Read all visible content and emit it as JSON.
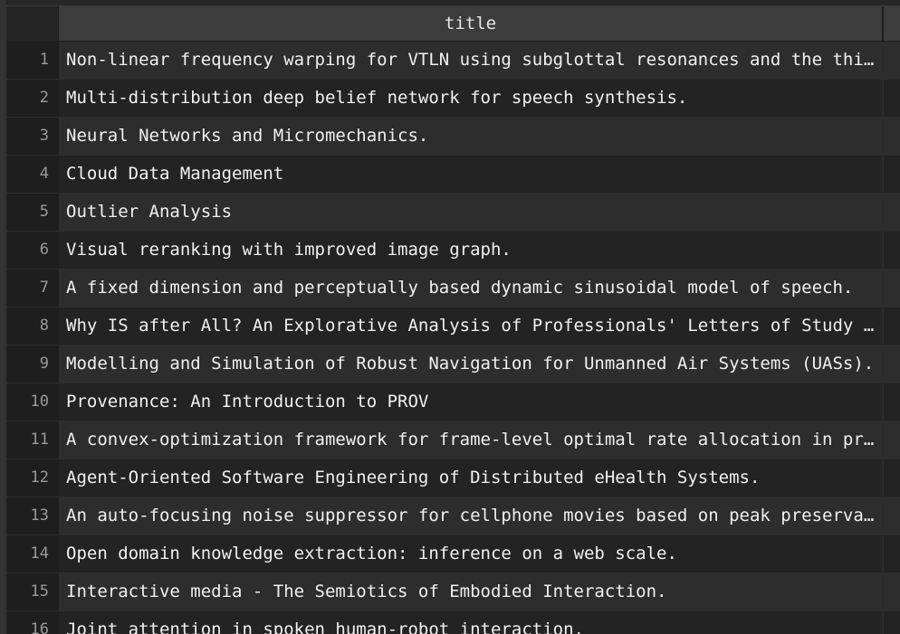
{
  "table": {
    "column_header": "title",
    "rows": [
      {
        "num": "1",
        "title": "Non-linear frequency warping for VTLN using subglottal resonances and the third formant frequency."
      },
      {
        "num": "2",
        "title": "Multi-distribution deep belief network for speech synthesis."
      },
      {
        "num": "3",
        "title": "Neural Networks and Micromechanics."
      },
      {
        "num": "4",
        "title": "Cloud Data Management"
      },
      {
        "num": "5",
        "title": "Outlier Analysis"
      },
      {
        "num": "6",
        "title": "Visual reranking with improved image graph."
      },
      {
        "num": "7",
        "title": "A fixed dimension and perceptually based dynamic sinusoidal model of speech."
      },
      {
        "num": "8",
        "title": "Why IS after All? An Explorative Analysis of Professionals' Letters of Study Motivation."
      },
      {
        "num": "9",
        "title": "Modelling and Simulation of Robust Navigation for Unmanned Air Systems (UASs)."
      },
      {
        "num": "10",
        "title": "Provenance: An Introduction to PROV"
      },
      {
        "num": "11",
        "title": "A convex-optimization framework for frame-level optimal rate allocation in predictive video coding."
      },
      {
        "num": "12",
        "title": "Agent-Oriented Software Engineering of Distributed eHealth Systems."
      },
      {
        "num": "13",
        "title": "An auto-focusing noise suppressor for cellphone movies based on peak preservation."
      },
      {
        "num": "14",
        "title": "Open domain knowledge extraction: inference on a web scale."
      },
      {
        "num": "15",
        "title": "Interactive media - The Semiotics of Embodied Interaction."
      },
      {
        "num": "16",
        "title": "Joint attention in spoken human-robot interaction."
      }
    ]
  }
}
